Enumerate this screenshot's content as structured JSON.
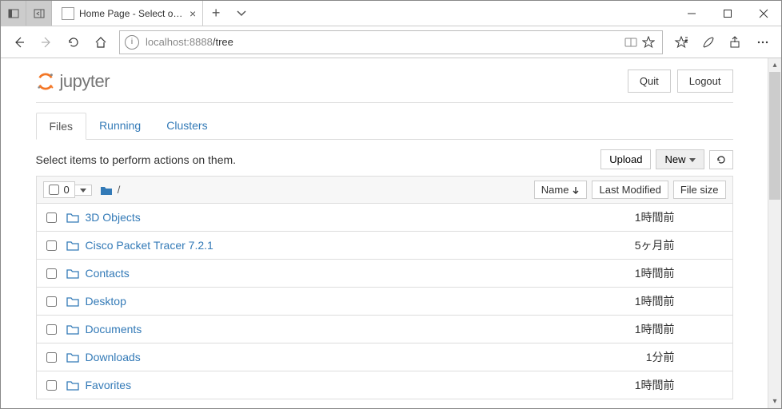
{
  "window": {
    "tab_title": "Home Page - Select or c"
  },
  "address": {
    "host": "localhost:8888",
    "path": "/tree"
  },
  "header": {
    "logo_text": "jupyter",
    "quit_label": "Quit",
    "logout_label": "Logout"
  },
  "tabs": {
    "files": "Files",
    "running": "Running",
    "clusters": "Clusters"
  },
  "toolbar": {
    "hint": "Select items to perform actions on them.",
    "upload_label": "Upload",
    "new_label": "New",
    "select_count": "0"
  },
  "columns": {
    "name": "Name",
    "last_modified": "Last Modified",
    "file_size": "File size"
  },
  "breadcrumb": {
    "path": "/"
  },
  "items": [
    {
      "name": "3D Objects",
      "modified": "1時間前"
    },
    {
      "name": "Cisco Packet Tracer 7.2.1",
      "modified": "5ヶ月前"
    },
    {
      "name": "Contacts",
      "modified": "1時間前"
    },
    {
      "name": "Desktop",
      "modified": "1時間前"
    },
    {
      "name": "Documents",
      "modified": "1時間前"
    },
    {
      "name": "Downloads",
      "modified": "1分前"
    },
    {
      "name": "Favorites",
      "modified": "1時間前"
    }
  ]
}
